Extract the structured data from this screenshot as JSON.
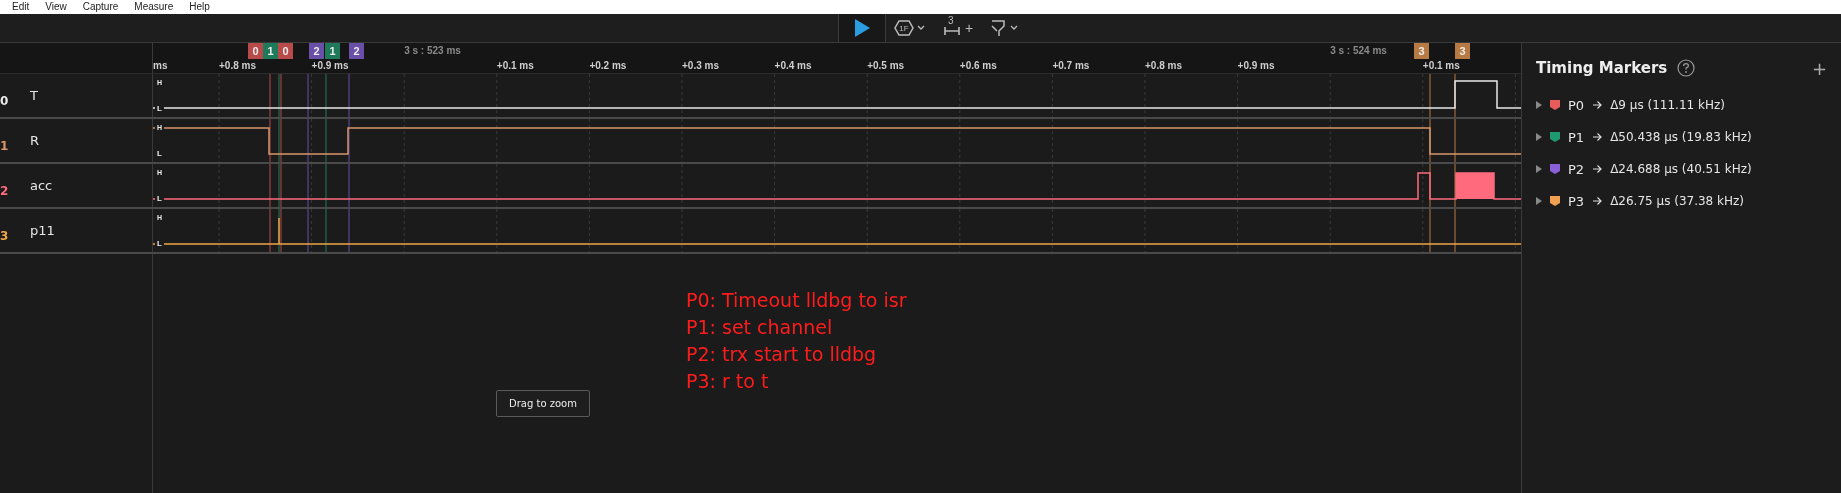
{
  "menu_bar": {
    "items": [
      "Edit",
      "View",
      "Capture",
      "Measure",
      "Help"
    ]
  },
  "toolbar": {
    "trigger_icon_text": "1F",
    "measure_icon_text": "3",
    "add_sign": "+"
  },
  "time_axis": {
    "labels": [
      {
        "text": "ms",
        "kind": "edge"
      },
      {
        "text": "+0.8 ms",
        "kind": "minor"
      },
      {
        "text": "+0.9 ms",
        "kind": "minor"
      },
      {
        "text": "3 s : 523 ms",
        "kind": "major"
      },
      {
        "text": "+0.1 ms",
        "kind": "minor"
      },
      {
        "text": "+0.2 ms",
        "kind": "minor"
      },
      {
        "text": "+0.3 ms",
        "kind": "minor"
      },
      {
        "text": "+0.4 ms",
        "kind": "minor"
      },
      {
        "text": "+0.5 ms",
        "kind": "minor"
      },
      {
        "text": "+0.6 ms",
        "kind": "minor"
      },
      {
        "text": "+0.7 ms",
        "kind": "minor"
      },
      {
        "text": "+0.8 ms",
        "kind": "minor"
      },
      {
        "text": "+0.9 ms",
        "kind": "minor"
      },
      {
        "text": "3 s : 524 ms",
        "kind": "major"
      },
      {
        "text": "+0.1 ms",
        "kind": "minor"
      }
    ]
  },
  "markers": [
    {
      "label": "0",
      "color": "#b84a4a"
    },
    {
      "label": "1",
      "color": "#1f7a5c"
    },
    {
      "label": "0",
      "color": "#b84a4a"
    },
    {
      "label": "2",
      "color": "#6a4fa8"
    },
    {
      "label": "1",
      "color": "#1f7a5c"
    },
    {
      "label": "2",
      "color": "#6a4fa8"
    },
    {
      "label": "3",
      "color": "#b87a45"
    },
    {
      "label": "3",
      "color": "#b87a45"
    }
  ],
  "channels": [
    {
      "index": "0",
      "name": "T",
      "color": "#e8e8e8",
      "high_label": "H",
      "low_label": "L"
    },
    {
      "index": "1",
      "name": "R",
      "color": "#d9976a",
      "high_label": "H",
      "low_label": "L"
    },
    {
      "index": "2",
      "name": "acc",
      "color": "#ff6b7d",
      "high_label": "H",
      "low_label": "L"
    },
    {
      "index": "3",
      "name": "p11",
      "color": "#f0a447",
      "high_label": "H",
      "low_label": "L"
    }
  ],
  "annotation": {
    "lines": [
      "P0: Timeout lldbg to isr",
      "P1: set channel",
      "P2: trx start to lldbg",
      "P3: r to t"
    ]
  },
  "drag_button": "Drag to zoom",
  "timing_markers": {
    "title": "Timing Markers",
    "add_sign": "+",
    "items": [
      {
        "name": "P0",
        "value": "Δ9 μs (111.11 kHz)",
        "color": "#e85c5c",
        "expanded": false
      },
      {
        "name": "P1",
        "value": "Δ50.438 μs (19.83 kHz)",
        "color": "#1f9a6e",
        "expanded": false
      },
      {
        "name": "P2",
        "value": "Δ24.688 μs (40.51 kHz)",
        "color": "#8a5fd8",
        "expanded": false
      },
      {
        "name": "P3",
        "value": "Δ26.75 μs (37.38 kHz)",
        "color": "#f0a050",
        "expanded": false
      }
    ]
  }
}
